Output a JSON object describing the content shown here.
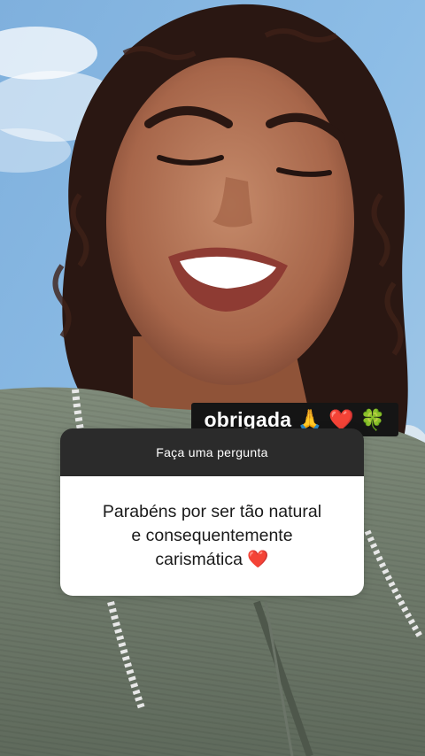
{
  "sticker": {
    "text": "obrigada 🙏 ❤️ 🍀"
  },
  "question_box": {
    "header": "Faça uma pergunta",
    "answer": "Parabéns por ser tão natural\ne consequentemente\ncarismática ❤️"
  }
}
